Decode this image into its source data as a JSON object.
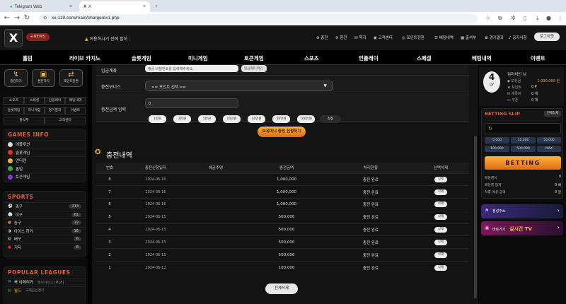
{
  "browser": {
    "tabs": [
      {
        "label": "Telegram Web"
      },
      {
        "label": "X"
      }
    ],
    "url": "xx-119.com/main/charge/ex1.php",
    "new_tab": "+"
  },
  "header": {
    "logo": "X",
    "news_badge": "NEWS",
    "ticker": "이용하시기 전에 필히 ;",
    "links": [
      "충전",
      "환전",
      "쪽지",
      "고객센터",
      "포인트전환",
      "베팅내역",
      "출석부",
      "경기결과",
      "공지사항"
    ],
    "logout": "로그아웃"
  },
  "nav": [
    "홀덤",
    "라이브 카지노",
    "슬롯게임",
    "미니게임",
    "토큰게임",
    "스포츠",
    "인플레이",
    "스페셜",
    "베팅내역",
    "이벤트"
  ],
  "left": {
    "quick": [
      {
        "label": "충전하기",
        "icon": "↯"
      },
      {
        "label": "환전하기",
        "icon": "▣"
      },
      {
        "label": "포인트전환",
        "icon": "⇄"
      }
    ],
    "grid": [
      [
        "스포츠",
        "스페셜",
        "인플레이",
        "배팅내역"
      ],
      [
        "슬롯게임",
        "미니게임",
        "경기결과",
        "이벤트"
      ],
      [
        "출석부",
        "",
        "고객센터",
        ""
      ]
    ],
    "games_title": "GAMES INFO",
    "games": [
      {
        "label": "에볼루션",
        "color": "#d8d8d8"
      },
      {
        "label": "슬롯게임",
        "color": "#e03030"
      },
      {
        "label": "언더젠",
        "color": "#e8b040"
      },
      {
        "label": "홀덤",
        "color": "#3aaa3a"
      },
      {
        "label": "토큰게임",
        "color": "#8a3ad8"
      }
    ],
    "sports_title": "SPORTS",
    "sports": [
      {
        "label": "축구",
        "count": "213"
      },
      {
        "label": "야구",
        "count": "61"
      },
      {
        "label": "농구",
        "count": "19"
      },
      {
        "label": "아이스 하키",
        "count": "16"
      },
      {
        "label": "배구",
        "count": "6"
      },
      {
        "label": "기타",
        "count": "8"
      }
    ],
    "leagues_title": "POPULAR LEAGUES",
    "leagues": [
      {
        "label": "북 아메리카",
        "sub": "메이저리그 (MLB)"
      },
      {
        "label": "월드",
        "sub": "국제친선경기"
      }
    ]
  },
  "form": {
    "depositor_label": "입금계좌",
    "depositor_placeholder": "출금 비밀번호를 입력해주세요.",
    "depositor_btn": "입금계좌 확인",
    "bonus_label": "충전보너스",
    "bonus_value": "== 포인트 선택 ==",
    "amount_label": "충전금액 입력",
    "amount_value": "0",
    "amounts": [
      "1만원",
      "3만원",
      "5만원",
      "10만원",
      "30만원",
      "50만원",
      "100만원"
    ],
    "reset": "정정",
    "submit": "보유머니 충전 신청하기"
  },
  "history": {
    "title": "충전내역",
    "headers": [
      "번호",
      "충전신청일자",
      "예금주명",
      "충전금액",
      "처리현황",
      "선택삭제"
    ],
    "rows": [
      {
        "no": "8",
        "date": "2024-06-16",
        "name": "",
        "amount": "1,000,000",
        "status": "충전 완료",
        "del": "삭제"
      },
      {
        "no": "7",
        "date": "2024-06-16",
        "name": "",
        "amount": "1,000,000",
        "status": "충전 완료",
        "del": "삭제"
      },
      {
        "no": "6",
        "date": "2024-06-16",
        "name": "",
        "amount": "1,000,000",
        "status": "충전 완료",
        "del": "삭제"
      },
      {
        "no": "5",
        "date": "2024-06-15",
        "name": "",
        "amount": "500,000",
        "status": "충전 완료",
        "del": "삭제"
      },
      {
        "no": "4",
        "date": "2024-06-15",
        "name": "",
        "amount": "500,000",
        "status": "충전 완료",
        "del": "삭제"
      },
      {
        "no": "3",
        "date": "2024-06-15",
        "name": "",
        "amount": "500,000",
        "status": "충전 완료",
        "del": "삭제"
      },
      {
        "no": "2",
        "date": "2024-06-15",
        "name": "",
        "amount": "500,000",
        "status": "충전 완료",
        "del": "삭제"
      },
      {
        "no": "1",
        "date": "2024-06-12",
        "name": "",
        "amount": "100,000",
        "status": "충전 완료",
        "del": "삭제"
      }
    ],
    "delete_all": "전체삭제"
  },
  "profile": {
    "level": "4",
    "level_label": "LV",
    "name": "검러처인 님",
    "rows": [
      {
        "label": "보유금",
        "value": "1,000,000 원"
      },
      {
        "label": "포인트",
        "value": "0 P"
      },
      {
        "label": "새쪽지",
        "value": "0 개"
      },
      {
        "label": "쿠폰",
        "value": "0 개"
      }
    ]
  },
  "betslip": {
    "title": "BETTING SLIP",
    "clear": "전체삭제",
    "amounts": [
      "5,000",
      "10,000",
      "50,000",
      "100,000",
      "500,000",
      "MAX"
    ],
    "bet": "BETTING",
    "info": [
      {
        "label": "배당률이",
        "value": "0"
      },
      {
        "label": "배당률 합계",
        "value": "0 배"
      },
      {
        "label": "적중 예상 금액",
        "value": "0 원"
      }
    ]
  },
  "promos": [
    {
      "label": "정성주소",
      "highlight": ""
    },
    {
      "label": "바로가기",
      "highlight": "실시간 TV"
    }
  ]
}
